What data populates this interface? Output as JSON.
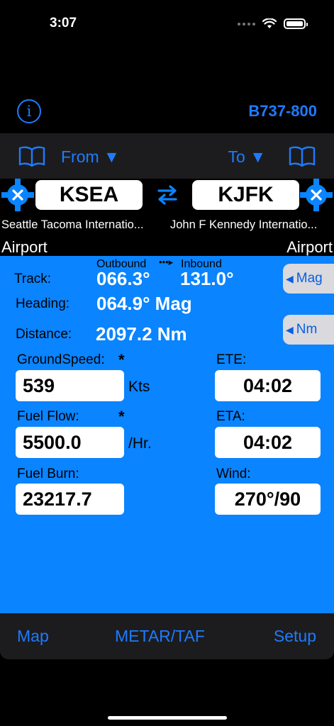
{
  "status_bar": {
    "time": "3:07"
  },
  "header": {
    "info_icon": "info-icon",
    "aircraft": "B737-800"
  },
  "airport_bar": {
    "from_label": "From ▼",
    "to_label": "To ▼",
    "from_code": "KSEA",
    "to_code": "KJFK",
    "from_name": "Seattle Tacoma Internatio...",
    "to_name": "John F Kennedy Internatio...",
    "from_suffix": "Airport",
    "to_suffix": "Airport"
  },
  "flight": {
    "outbound_label": "Outbound",
    "inbound_label": "Inbound",
    "arrow": "•••▸",
    "track_label": "Track:",
    "track_outbound": "066.3°",
    "track_inbound": "131.0°",
    "mag_button": "Mag",
    "heading_label": "Heading:",
    "heading_value": "064.9° Mag",
    "distance_label": "Distance:",
    "distance_value": "2097.2 Nm",
    "nm_button": "Nm",
    "groundspeed_label": "GroundSpeed:",
    "groundspeed_star": "*",
    "groundspeed_value": "539",
    "groundspeed_unit": "Kts",
    "ete_label": "ETE:",
    "ete_value": "04:02",
    "fuelflow_label": "Fuel Flow:",
    "fuelflow_star": "*",
    "fuelflow_value": "5500.0",
    "fuelflow_unit": "/Hr.",
    "eta_label": "ETA:",
    "eta_value": "04:02",
    "fuelburn_label": "Fuel Burn:",
    "fuelburn_value": "23217.7",
    "wind_label": "Wind:",
    "wind_value": "270°/90"
  },
  "tabs": {
    "map": "Map",
    "metar": "METAR/TAF",
    "setup": "Setup"
  },
  "colors": {
    "accent": "#1e7bff",
    "panel": "#0a84ff",
    "bar": "#1c1c1e"
  }
}
